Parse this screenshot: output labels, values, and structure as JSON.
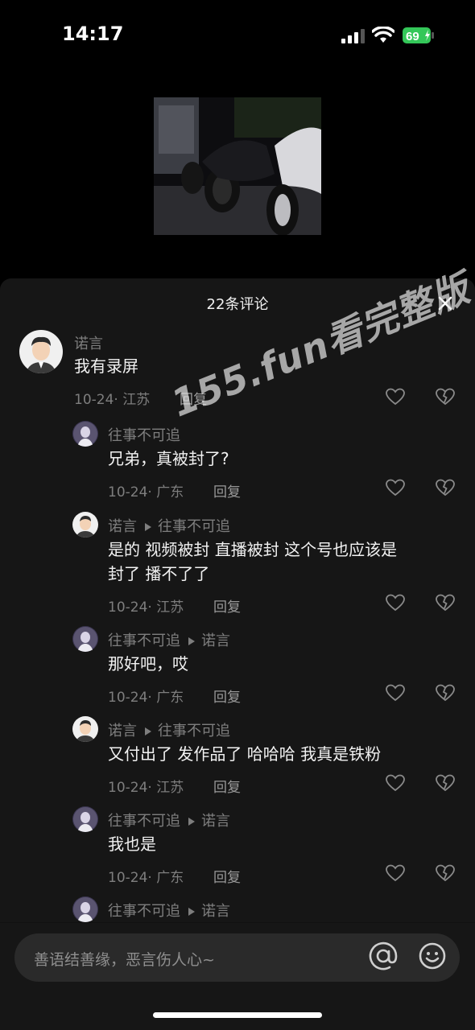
{
  "status_bar": {
    "time": "14:17",
    "battery": "69"
  },
  "sheet": {
    "title": "22条评论"
  },
  "watermark": "155.fun看完整版",
  "comments": [
    {
      "name": "诺言",
      "text": "我有录屏",
      "date": "10-24",
      "location": "江苏",
      "reply": "回复"
    },
    {
      "name": "往事不可追",
      "text": "兄弟，真被封了?",
      "date": "10-24",
      "location": "广东",
      "reply": "回复"
    },
    {
      "name": "诺言",
      "reply_to": "往事不可追",
      "text_line1": "是的 视频被封  直播被封   这个号也应该是",
      "text_line2": "封了  播不了了",
      "date": "10-24",
      "location": "江苏",
      "reply": "回复"
    },
    {
      "name": "往事不可追",
      "reply_to": "诺言",
      "text": "那好吧，哎",
      "date": "10-24",
      "location": "广东",
      "reply": "回复"
    },
    {
      "name": "诺言",
      "reply_to": "往事不可追",
      "text": "又付出了 发作品了  哈哈哈 我真是铁粉",
      "date": "10-24",
      "location": "江苏",
      "reply": "回复"
    },
    {
      "name": "往事不可追",
      "reply_to": "诺言",
      "text": "我也是",
      "date": "10-24",
      "location": "广东",
      "reply": "回复"
    },
    {
      "name": "往事不可追",
      "reply_to": "诺言"
    }
  ],
  "input": {
    "placeholder": "善语结善缘，恶言伤人心~"
  },
  "icons": {
    "at": "at-icon",
    "emoji": "emoji-icon",
    "heart": "heart-icon",
    "dislike": "broken-heart-icon",
    "close": "close-icon"
  }
}
